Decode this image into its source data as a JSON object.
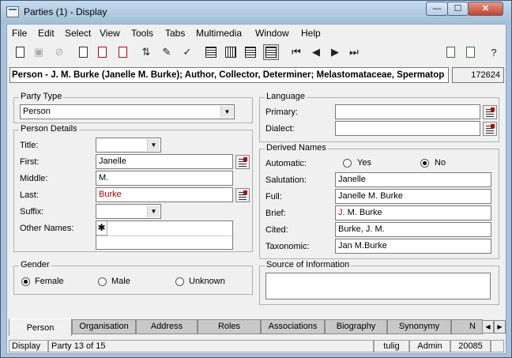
{
  "window": {
    "title": "Parties (1) - Display",
    "min_glyph": "—",
    "max_glyph": "☐",
    "close_glyph": "✕"
  },
  "menu": [
    "File",
    "Edit",
    "Select",
    "View",
    "Tools",
    "Tabs",
    "Multimedia",
    "Window",
    "Help"
  ],
  "toolbar_icons": [
    "new-icon",
    "save-icon",
    "cancel-icon",
    "print-icon",
    "print-all-icon",
    "print-current-icon",
    "sort-icon",
    "edit-notes-icon",
    "spellcheck-icon",
    "form-view-icon",
    "grid-view-icon",
    "page-view-icon",
    "record-view-icon",
    "first-record-icon",
    "previous-record-icon",
    "next-record-icon",
    "last-record-icon",
    "copy-icon",
    "duplicate-icon",
    "help-icon"
  ],
  "record": {
    "name": "Person - J. M. Burke (Janelle M. Burke); Author, Collector, Determiner; Melastomataceae, Spermatop",
    "id": "172624"
  },
  "party_type": {
    "label": "Party Type",
    "value": "Person"
  },
  "person_details": {
    "label": "Person Details",
    "title_label": "Title:",
    "title_value": "",
    "first_label": "First:",
    "first_value": "Janelle",
    "middle_label": "Middle:",
    "middle_value": "M.",
    "last_label": "Last:",
    "last_value": "Burke",
    "suffix_label": "Suffix:",
    "suffix_value": "",
    "other_names_label": "Other Names:",
    "other_names_row_marker": "✱"
  },
  "gender": {
    "label": "Gender",
    "options": [
      "Female",
      "Male",
      "Unknown"
    ],
    "selected": "Female"
  },
  "language": {
    "label": "Language",
    "primary_label": "Primary:",
    "primary_value": "",
    "dialect_label": "Dialect:",
    "dialect_value": ""
  },
  "derived_names": {
    "label": "Derived Names",
    "automatic_label": "Automatic:",
    "yes_label": "Yes",
    "no_label": "No",
    "automatic_selected": "No",
    "salutation_label": "Salutation:",
    "salutation_value": "Janelle",
    "full_label": "Full:",
    "full_value": "Janelle M. Burke",
    "brief_label": "Brief:",
    "brief_initial": "J.",
    "brief_rest": " M. Burke",
    "cited_label": "Cited:",
    "cited_value": "Burke, J. M.",
    "taxonomic_label": "Taxonomic:",
    "taxonomic_value": "Jan M.Burke"
  },
  "source": {
    "label": "Source of Information",
    "value": ""
  },
  "tabs": [
    "Person",
    "Organisation",
    "Address",
    "Roles",
    "Associations",
    "Biography",
    "Synonymy",
    "N"
  ],
  "active_tab": "Person",
  "status": {
    "mode": "Display",
    "position": "Party 13 of 15",
    "blank": "",
    "user": "tulig",
    "role": "Admin",
    "number": "20085"
  },
  "colors": {
    "accent_red": "#c00000",
    "close_button": "#c8432a",
    "titlebar": "#a9c3da"
  }
}
